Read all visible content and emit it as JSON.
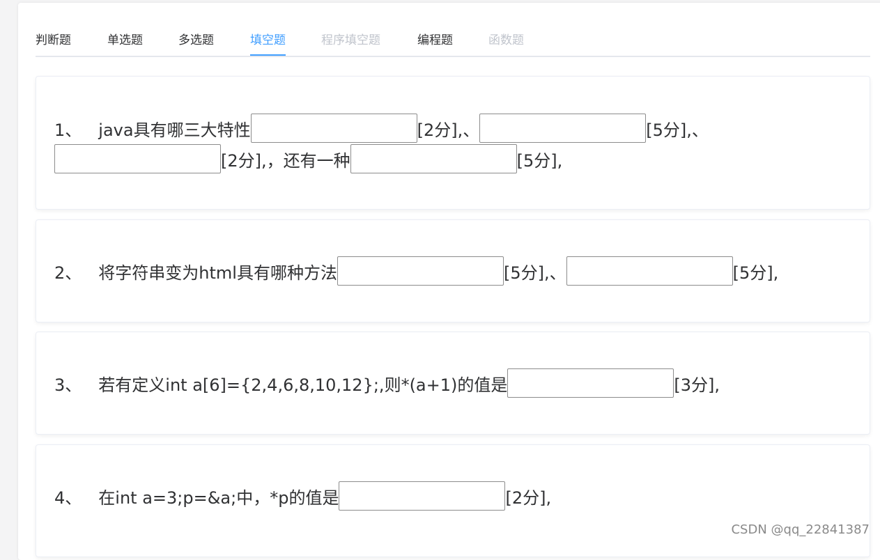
{
  "tabs": [
    {
      "label": "判断题",
      "state": "normal"
    },
    {
      "label": "单选题",
      "state": "normal"
    },
    {
      "label": "多选题",
      "state": "normal"
    },
    {
      "label": "填空题",
      "state": "active"
    },
    {
      "label": "程序填空题",
      "state": "disabled"
    },
    {
      "label": "编程题",
      "state": "normal"
    },
    {
      "label": "函数题",
      "state": "disabled"
    }
  ],
  "questions": [
    {
      "number": "1、",
      "stem": "java具有哪三大特性",
      "parts": {
        "b1_score": "[2分],、",
        "b2_score": "[5分],、",
        "b3_score": "[2分],，还有一种",
        "b4_score": "[5分],"
      },
      "blanks": [
        "",
        "",
        "",
        ""
      ]
    },
    {
      "number": "2、",
      "stem": "将字符串变为html具有哪种方法",
      "parts": {
        "b1_score": "[5分],、",
        "b2_score": "[5分],"
      },
      "blanks": [
        "",
        ""
      ]
    },
    {
      "number": "3、",
      "stem": "若有定义int a[6]={2,4,6,8,10,12};,则*(a+1)的值是",
      "parts": {
        "b1_score": "[3分],"
      },
      "blanks": [
        ""
      ]
    },
    {
      "number": "4、",
      "stem": "在int a=3;p=&a;中，*p的值是",
      "parts": {
        "b1_score": "[2分],"
      },
      "blanks": [
        ""
      ]
    }
  ],
  "watermark": "CSDN @qq_22841387",
  "colors": {
    "accent": "#409eff",
    "text": "#303133",
    "disabled": "#c0c4cc"
  }
}
